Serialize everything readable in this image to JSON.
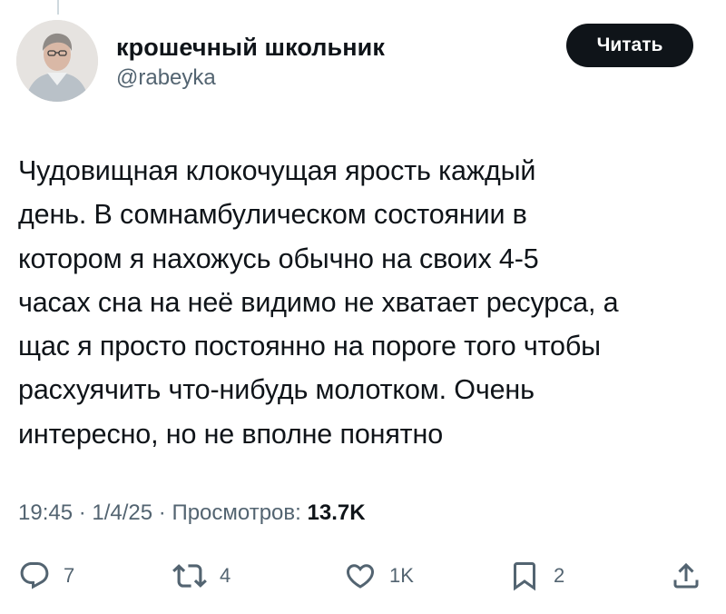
{
  "author": {
    "name": "крошечный школьник",
    "handle": "@rabeyka",
    "avatar_icon": "user-avatar"
  },
  "follow_button": {
    "label": "Читать",
    "color": "#0f1419"
  },
  "tweet": {
    "text": "Чудовищная клокочущая ярость каждый\nдень. В сомнамбулическом состоянии в\nкотором я нахожусь обычно на своих 4-5\nчасах сна на неё видимо не хватает ресурса, а\nщас я просто постоянно на пороге того чтобы\nрасхуячить что-нибудь молотком. Очень\nинтересно, но не вполне понятно"
  },
  "meta": {
    "time": "19:45",
    "separator": " · ",
    "date": "1/4/25",
    "views_label": "Просмотров:",
    "views_count": "13.7K"
  },
  "actions": {
    "reply": {
      "icon": "reply-icon",
      "count": "7"
    },
    "retweet": {
      "icon": "retweet-icon",
      "count": "4"
    },
    "like": {
      "icon": "heart-icon",
      "count": "1K"
    },
    "bookmark": {
      "icon": "bookmark-icon",
      "count": "2"
    },
    "share": {
      "icon": "share-icon"
    }
  },
  "colors": {
    "text_primary": "#0f1419",
    "text_secondary": "#536471",
    "background": "#ffffff"
  }
}
